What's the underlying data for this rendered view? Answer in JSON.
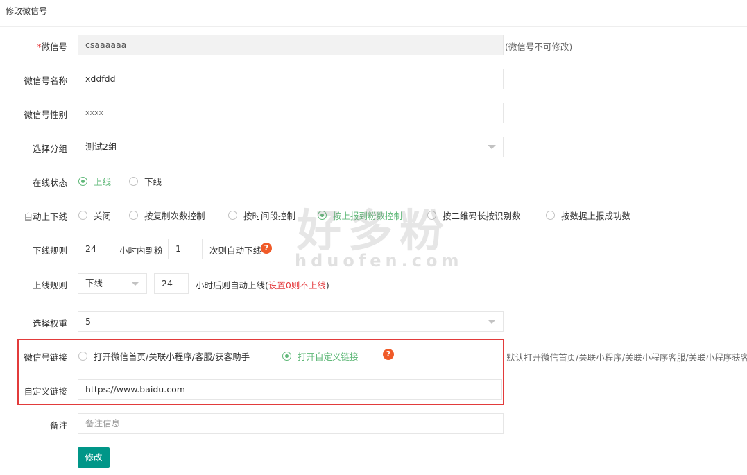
{
  "page": {
    "title": "修改微信号"
  },
  "form": {
    "wechat_id": {
      "label": "微信号",
      "required_mark": "*",
      "value": "csaaaaaa",
      "note": "(微信号不可修改)"
    },
    "wechat_name": {
      "label": "微信号名称",
      "value": "xddfdd"
    },
    "wechat_gender": {
      "label": "微信号性别",
      "value": "xxxx"
    },
    "group": {
      "label": "选择分组",
      "selected": "测试2组"
    },
    "online_status": {
      "label": "在线状态",
      "options": [
        "上线",
        "下线"
      ],
      "selected": "上线"
    },
    "auto_switch": {
      "label": "自动上下线",
      "options": [
        "关闭",
        "按复制次数控制",
        "按时间段控制",
        "按上报到粉数控制",
        "按二维码长按识别数",
        "按数据上报成功数"
      ],
      "selected": "按上报到粉数控制"
    },
    "offline_rule": {
      "label": "下线规则",
      "hours": "24",
      "text1": "小时内到粉",
      "count": "1",
      "text2": "次则自动下线"
    },
    "online_rule": {
      "label": "上线规则",
      "action": "下线",
      "hours": "24",
      "text1": "小时后则自动上线(",
      "text_red": "设置0则不上线",
      "text2": ")"
    },
    "weight": {
      "label": "选择权重",
      "selected": "5"
    },
    "link_type": {
      "label": "微信号链接",
      "options": [
        "打开微信首页/关联小程序/客服/获客助手",
        "打开自定义链接"
      ],
      "selected": "打开自定义链接",
      "note": "默认打开微信首页/关联小程序/关联小程序客服/关联小程序获客助手"
    },
    "custom_link": {
      "label": "自定义链接",
      "value": "https://www.baidu.com"
    },
    "remark": {
      "label": "备注",
      "placeholder": "备注信息"
    },
    "submit": {
      "label": "修改"
    }
  },
  "help_icon": {
    "glyph": "?",
    "color": "#f05a28"
  },
  "watermark": {
    "cn": "好多粉",
    "en": "hduofen.com"
  },
  "colors": {
    "accent_green": "#5fb878",
    "button_teal": "#009688",
    "highlight_red": "#e23b3b"
  }
}
